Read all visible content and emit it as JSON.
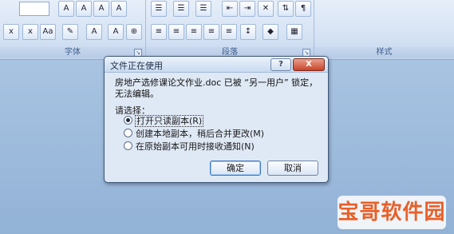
{
  "ribbon": {
    "font_group_label": "字体",
    "paragraph_group_label": "段落",
    "styles_group_label": "样式",
    "buttons": [
      "A",
      "A",
      "Aa",
      "A",
      "A",
      "A"
    ]
  },
  "dialog": {
    "title": "文件正在使用",
    "help_label": "?",
    "close_label": "X",
    "message": "房地产选修课论文作业.doc 已被 “另一用户” 锁定，无法编辑。",
    "choose_label": "请选择：",
    "options": [
      {
        "label": "打开只读副本(R)",
        "selected": true
      },
      {
        "label": "创建本地副本，稍后合并更改(M)",
        "selected": false
      },
      {
        "label": "在原始副本可用时接收通知(N)",
        "selected": false
      }
    ],
    "ok_label": "确定",
    "cancel_label": "取消"
  },
  "watermark": {
    "text": "宝哥软件园",
    "color": "#e8602a"
  }
}
